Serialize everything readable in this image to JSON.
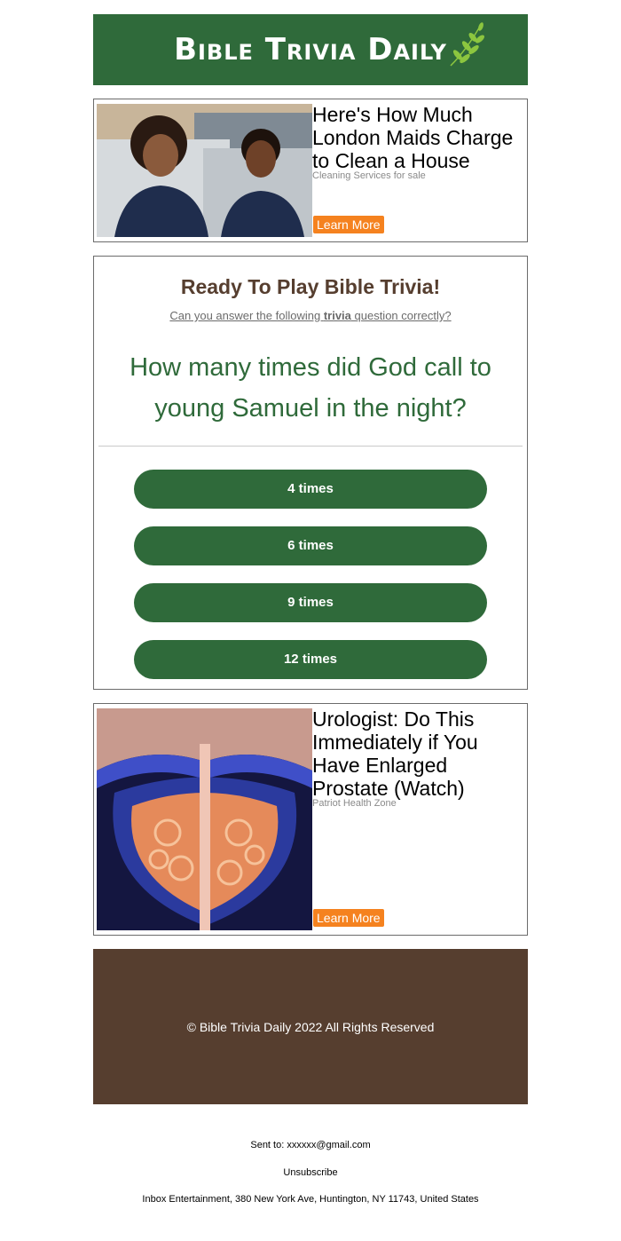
{
  "header": {
    "title": "Bible Trivia Daily",
    "accent": "#2f6a3a"
  },
  "ad_top": {
    "headline": "Here's How Much London Maids Charge to Clean a House",
    "source": "Cleaning Services for sale",
    "cta": "Learn More"
  },
  "quiz": {
    "title": "Ready To Play Bible Trivia!",
    "subtitle_pre": "Can you answer the following ",
    "subtitle_bold": "trivia",
    "subtitle_post": " question correctly?",
    "question": "How many times did God call to young Samuel in the night?",
    "answers": [
      "4 times",
      "6 times",
      "9 times",
      "12 times"
    ]
  },
  "ad_bottom": {
    "headline": "Urologist: Do This Immediately if You Have Enlarged Prostate (Watch)",
    "source": "Patriot Health Zone",
    "cta": "Learn More"
  },
  "footer": {
    "copyright": "© Bible Trivia Daily 2022 All Rights Reserved",
    "sent_label": "Sent to: ",
    "sent_email": "xxxxxx@gmail.com",
    "unsubscribe": "Unsubscribe",
    "address": "Inbox Entertainment, 380 New York Ave, Huntington, NY 11743, United States"
  },
  "colors": {
    "green": "#2f6a3a",
    "brown": "#563e2f",
    "orange": "#f5821f"
  }
}
